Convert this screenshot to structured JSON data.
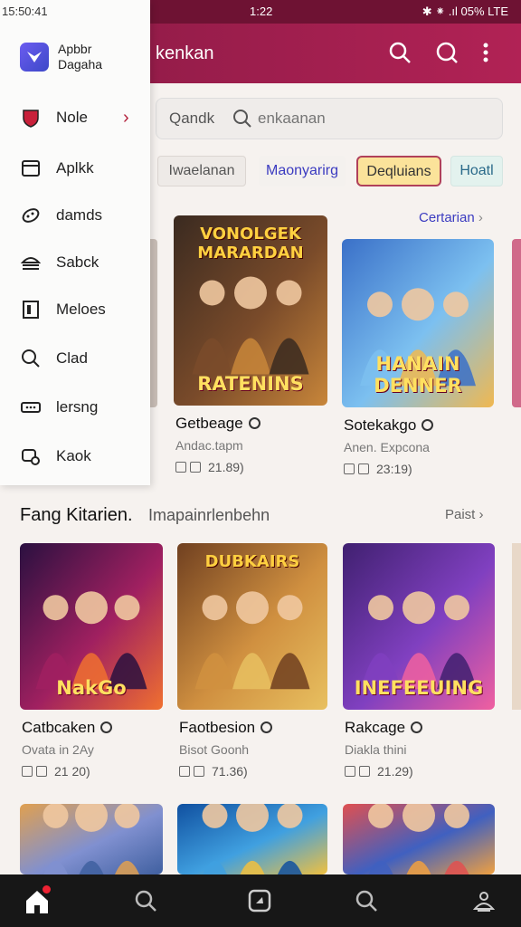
{
  "status_bar": {
    "time": "15:50:41",
    "center": "1:22",
    "right": "✱ ⁕ .ıl 05% LTE"
  },
  "app_bar": {
    "title": "kenkan"
  },
  "search": {
    "label": "Qandk",
    "placeholder": "enkaanan"
  },
  "chips": [
    {
      "label": "Iwaelanan",
      "bg": "#eeeae7",
      "fg": "#555",
      "border": "#dcd6d2"
    },
    {
      "label": "Maonyarirg",
      "bg": "#f4f1ee",
      "fg": "#3b3bc0",
      "border": "#f4f1ee"
    },
    {
      "label": "Deqluians",
      "bg": "#fbe39a",
      "fg": "#333",
      "border": "#b0405a"
    },
    {
      "label": "Hoatl",
      "bg": "#e3f2ee",
      "fg": "#2a6a8a",
      "border": "#d4e6e2"
    }
  ],
  "drawer": {
    "status_time": "15:50:41",
    "brand_line1": "Apbbr",
    "brand_line2": "Dagaha",
    "items": [
      {
        "icon": "shield-icon",
        "label": "Nole",
        "chevron": "›"
      },
      {
        "icon": "window-icon",
        "label": "Aplkk"
      },
      {
        "icon": "controller-icon",
        "label": "damds"
      },
      {
        "icon": "stack-icon",
        "label": "Sabck"
      },
      {
        "icon": "document-icon",
        "label": "Meloes"
      },
      {
        "icon": "search-icon",
        "label": "Clad"
      },
      {
        "icon": "ticket-icon",
        "label": "lersng"
      },
      {
        "icon": "settings-icon",
        "label": "Kaok"
      }
    ]
  },
  "section1": {
    "link": "Certarian",
    "link_chevron": "›"
  },
  "section2": {
    "title": "Fang Kitarien.",
    "subtitle": "Imapainrlenbehn",
    "link": "Paist",
    "link_chevron": "›"
  },
  "row1": [
    {
      "title": "Getbeage",
      "sub": "Andac.tapm",
      "meta": "21.89)",
      "art_top": "VONOLGEK MARARDAN",
      "art_bottom": "RATENINS",
      "colors": [
        "#3a2a20",
        "#7a4b2a",
        "#c8863a"
      ]
    },
    {
      "title": "Sotekakgo",
      "sub": "Anen. Expcona",
      "meta": "23:19)",
      "art_top": "",
      "art_bottom": "HANAIN DENNER",
      "colors": [
        "#3a70c8",
        "#7cc0f0",
        "#f0b850"
      ]
    }
  ],
  "row2": [
    {
      "title": "Catbcaken",
      "sub": "Ovata in 2Ay",
      "meta": "21 20)",
      "art_bottom": "NakGo",
      "colors": [
        "#2a1040",
        "#a02060",
        "#f07030"
      ]
    },
    {
      "title": "Faotbesion",
      "sub": "Bisot Goonh",
      "meta": "71.36)",
      "art_top": "DUBKAIRS",
      "colors": [
        "#704020",
        "#d09040",
        "#e8c060"
      ]
    },
    {
      "title": "Rakcage",
      "sub": "Diakla thini",
      "meta": "21.29)",
      "art_bottom": "INEFEEUING",
      "colors": [
        "#402070",
        "#8040c0",
        "#f060a0"
      ]
    }
  ],
  "row3": [
    {
      "colors": [
        "#e0a050",
        "#8090d0",
        "#4060a0"
      ]
    },
    {
      "colors": [
        "#1050a0",
        "#40a0e0",
        "#f0c040"
      ]
    },
    {
      "colors": [
        "#e05050",
        "#4060c0",
        "#f0a040"
      ]
    }
  ],
  "bottom_nav": [
    {
      "icon": "home-icon"
    },
    {
      "icon": "search-icon"
    },
    {
      "icon": "app-icon"
    },
    {
      "icon": "search-icon"
    },
    {
      "icon": "profile-icon"
    }
  ],
  "colors": {
    "accent": "#9c1c4a",
    "drawer_chevron": "#b3223c"
  }
}
